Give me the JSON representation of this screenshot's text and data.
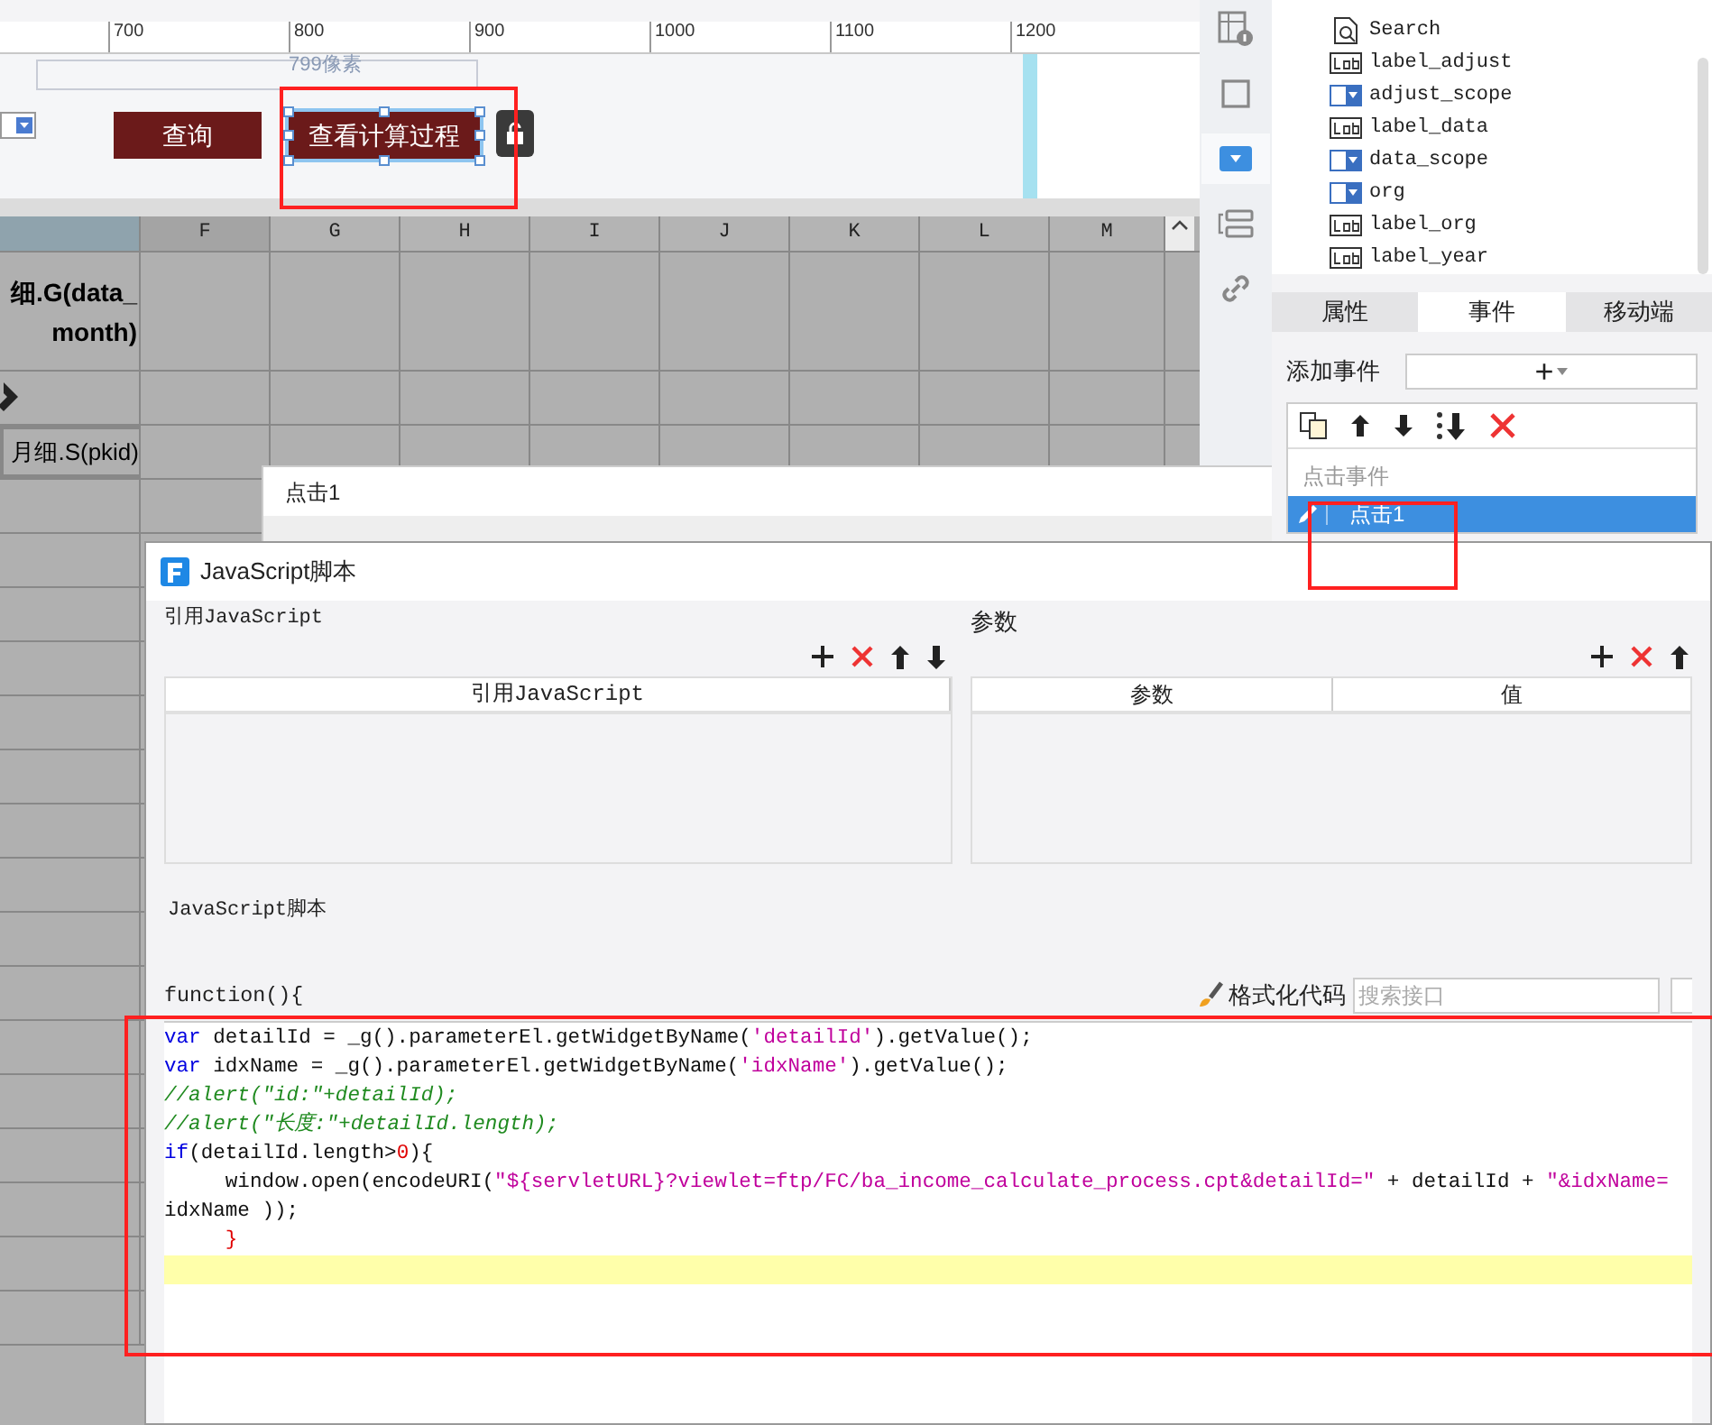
{
  "ruler": {
    "ticks": [
      "700",
      "800",
      "900",
      "1000",
      "1100",
      "1200"
    ]
  },
  "canvas": {
    "size_label": "799像素",
    "buttons": [
      {
        "label": "查询",
        "selected": false
      },
      {
        "label": "查看计算过程",
        "selected": true
      }
    ]
  },
  "grid": {
    "columns": [
      "F",
      "G",
      "H",
      "I",
      "J",
      "K",
      "L",
      "M"
    ],
    "cells": [
      {
        "text": "细.G(data_\nmonth)",
        "kind": "formula"
      },
      {
        "kind": "pencil"
      },
      {
        "text": "月细.S(pkid)",
        "kind": "selected"
      }
    ]
  },
  "tree": {
    "items": [
      {
        "label": "Search",
        "kind": "search"
      },
      {
        "label": "label_adjust",
        "kind": "label"
      },
      {
        "label": "adjust_scope",
        "kind": "combo"
      },
      {
        "label": "label_data",
        "kind": "label"
      },
      {
        "label": "data_scope",
        "kind": "combo"
      },
      {
        "label": "org",
        "kind": "combo"
      },
      {
        "label": "label_org",
        "kind": "label"
      },
      {
        "label": "label_year",
        "kind": "label"
      }
    ]
  },
  "panel_tabs": [
    {
      "label": "属性",
      "selected": false
    },
    {
      "label": "事件",
      "selected": true
    },
    {
      "label": "移动端",
      "selected": false
    }
  ],
  "add_event": {
    "label": "添加事件",
    "button": "+"
  },
  "events": {
    "header": "点击事件",
    "items": [
      {
        "label": "点击1",
        "selected": true
      }
    ]
  },
  "event_dialog": {
    "title": "点击1"
  },
  "js_dialog": {
    "title": "JavaScript脚本",
    "imports": {
      "title": "引用JavaScript",
      "columns": [
        "引用JavaScript"
      ]
    },
    "params": {
      "title": "参数",
      "columns": [
        "参数",
        "值"
      ]
    },
    "script": {
      "title": "JavaScript脚本",
      "header": "function(){",
      "format_label": "格式化代码",
      "search_placeholder": "搜索接口",
      "lines": [
        [
          {
            "text": "var",
            "kind": "keyword"
          },
          {
            "text": " detailId = _g().parameterEl.getWidgetByName(",
            "kind": "plain"
          },
          {
            "text": "'detailId'",
            "kind": "string"
          },
          {
            "text": ").getValue();",
            "kind": "plain"
          }
        ],
        [
          {
            "text": "var",
            "kind": "keyword"
          },
          {
            "text": " idxName = _g().parameterEl.getWidgetByName(",
            "kind": "plain"
          },
          {
            "text": "'idxName'",
            "kind": "string"
          },
          {
            "text": ").getValue();",
            "kind": "plain"
          }
        ],
        [
          {
            "text": "//alert(\"id:\"+detailId);",
            "kind": "comment"
          }
        ],
        [
          {
            "text": "//alert(\"长度:\"+detailId.length);",
            "kind": "comment"
          }
        ],
        [
          {
            "text": "if",
            "kind": "keyword"
          },
          {
            "text": "(detailId.length>",
            "kind": "plain"
          },
          {
            "text": "0",
            "kind": "number"
          },
          {
            "text": "){",
            "kind": "plain"
          }
        ],
        [
          {
            "text": "     window.open(encodeURI(",
            "kind": "plain"
          },
          {
            "text": "\"${servletURL}?viewlet=ftp/FC/ba_income_calculate_process.cpt&detailId=\"",
            "kind": "string"
          },
          {
            "text": " + detailId + ",
            "kind": "plain"
          },
          {
            "text": "\"&idxName=",
            "kind": "string"
          }
        ],
        [
          {
            "text": "idxName ));",
            "kind": "plain"
          }
        ],
        [
          {
            "text": "     }",
            "kind": "number"
          }
        ]
      ]
    }
  },
  "annotations": [
    {
      "kind": "highlight"
    },
    {
      "kind": "highlight"
    },
    {
      "kind": "highlight"
    }
  ]
}
